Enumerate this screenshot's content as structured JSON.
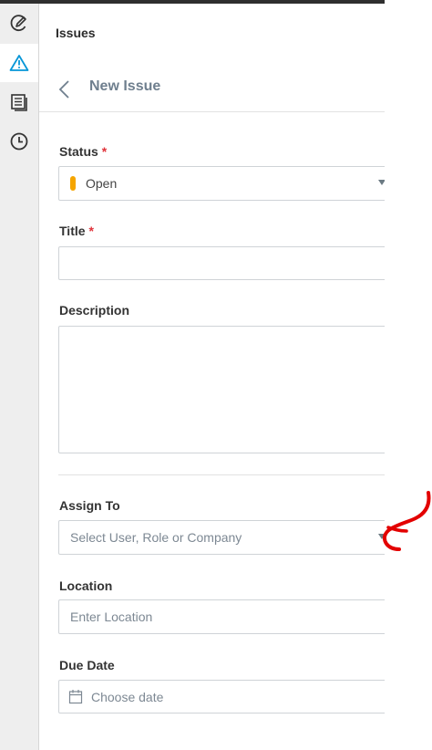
{
  "sidebar": {
    "items": [
      {
        "name": "markup-icon"
      },
      {
        "name": "warning-icon"
      },
      {
        "name": "sheets-icon"
      },
      {
        "name": "clock-icon"
      }
    ]
  },
  "panel": {
    "title": "Issues",
    "page_title": "New Issue"
  },
  "form": {
    "status": {
      "label": "Status",
      "required_mark": "*",
      "value": "Open",
      "status_color": "#f5a500"
    },
    "title": {
      "label": "Title",
      "required_mark": "*",
      "value": ""
    },
    "description": {
      "label": "Description",
      "value": ""
    },
    "assign_to": {
      "label": "Assign To",
      "placeholder": "Select User, Role or Company"
    },
    "location": {
      "label": "Location",
      "placeholder": "Enter Location"
    },
    "due_date": {
      "label": "Due Date",
      "placeholder": "Choose date"
    }
  },
  "colors": {
    "accent": "#0696d7",
    "required": "#e0333a",
    "annotation": "#e30000"
  }
}
